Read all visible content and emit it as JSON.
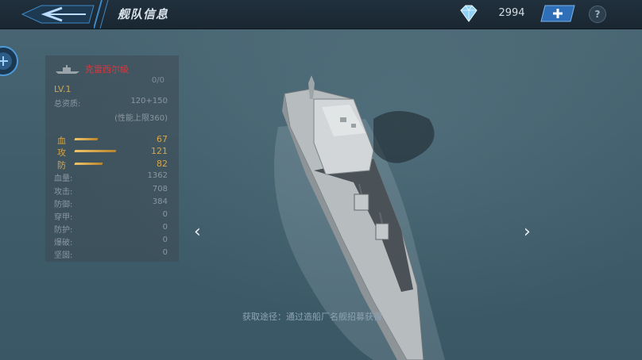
{
  "header": {
    "title": "舰队信息",
    "currency_value": "2994",
    "add_label": "+",
    "help_label": "?"
  },
  "info_panel": {
    "ship_name": "克雷西尔级",
    "count": "0/0",
    "level": "LV.1",
    "quality_label": "总资质:",
    "quality_value": "120+150",
    "quality_note": "(性能上限360)",
    "attributes": [
      {
        "label": "血",
        "value": "67",
        "fill": 0.55
      },
      {
        "label": "攻",
        "value": "121",
        "fill": 1.0
      },
      {
        "label": "防",
        "value": "82",
        "fill": 0.68
      }
    ],
    "stats": [
      {
        "label": "血量:",
        "value": "1362"
      },
      {
        "label": "攻击:",
        "value": "708"
      },
      {
        "label": "防御:",
        "value": "384"
      },
      {
        "label": "穿甲:",
        "value": "0"
      },
      {
        "label": "防护:",
        "value": "0"
      },
      {
        "label": "爆破:",
        "value": "0"
      },
      {
        "label": "坚固:",
        "value": "0"
      }
    ]
  },
  "nav": {
    "prev": "‹",
    "next": "›"
  },
  "acquire_text": "获取途径：通过造船厂名舰招募获得",
  "colors": {
    "ship_name": "#e0343a",
    "attribute": "#d6a648",
    "accent_blue": "#2f7fd8"
  }
}
